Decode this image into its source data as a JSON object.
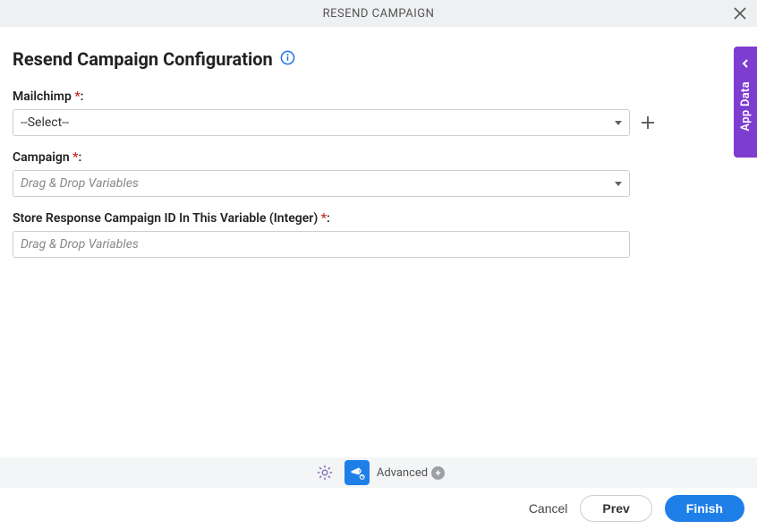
{
  "header": {
    "title": "RESEND CAMPAIGN"
  },
  "page": {
    "heading": "Resend Campaign Configuration"
  },
  "fields": {
    "mailchimp": {
      "label": "Mailchimp ",
      "value": "--Select--"
    },
    "campaign": {
      "label": "Campaign ",
      "placeholder": "Drag & Drop Variables"
    },
    "storeResponse": {
      "label": "Store Response Campaign ID In This Variable (Integer) ",
      "placeholder": "Drag & Drop Variables"
    }
  },
  "sideTab": {
    "label": "App Data"
  },
  "toolbar": {
    "advanced": "Advanced"
  },
  "footer": {
    "cancel": "Cancel",
    "prev": "Prev",
    "finish": "Finish"
  },
  "colors": {
    "primary": "#1f7fe8",
    "accent": "#7d3dd1"
  }
}
